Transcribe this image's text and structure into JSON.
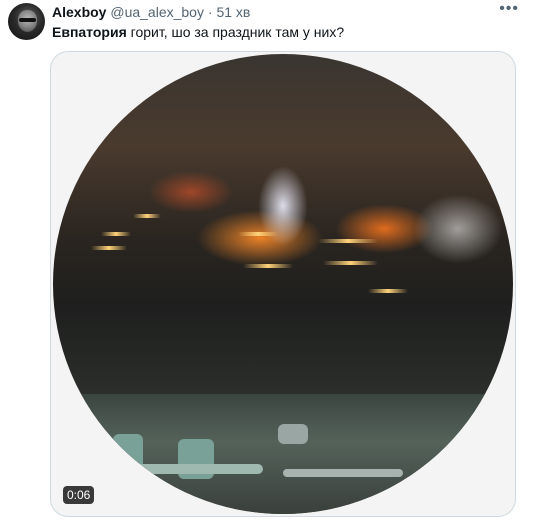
{
  "tweet": {
    "author_name": "Alexboy",
    "handle": "@ua_alex_boy",
    "separator": "·",
    "time": "51 хв",
    "more_icon": "more-horizontal-icon",
    "text_bold": "Евпатория",
    "text_rest": " горит, шо за праздник там у них?"
  },
  "media": {
    "duration": "0:06"
  },
  "colors": {
    "text": "#0f1419",
    "secondary": "#536471",
    "border": "#cfd9de"
  }
}
